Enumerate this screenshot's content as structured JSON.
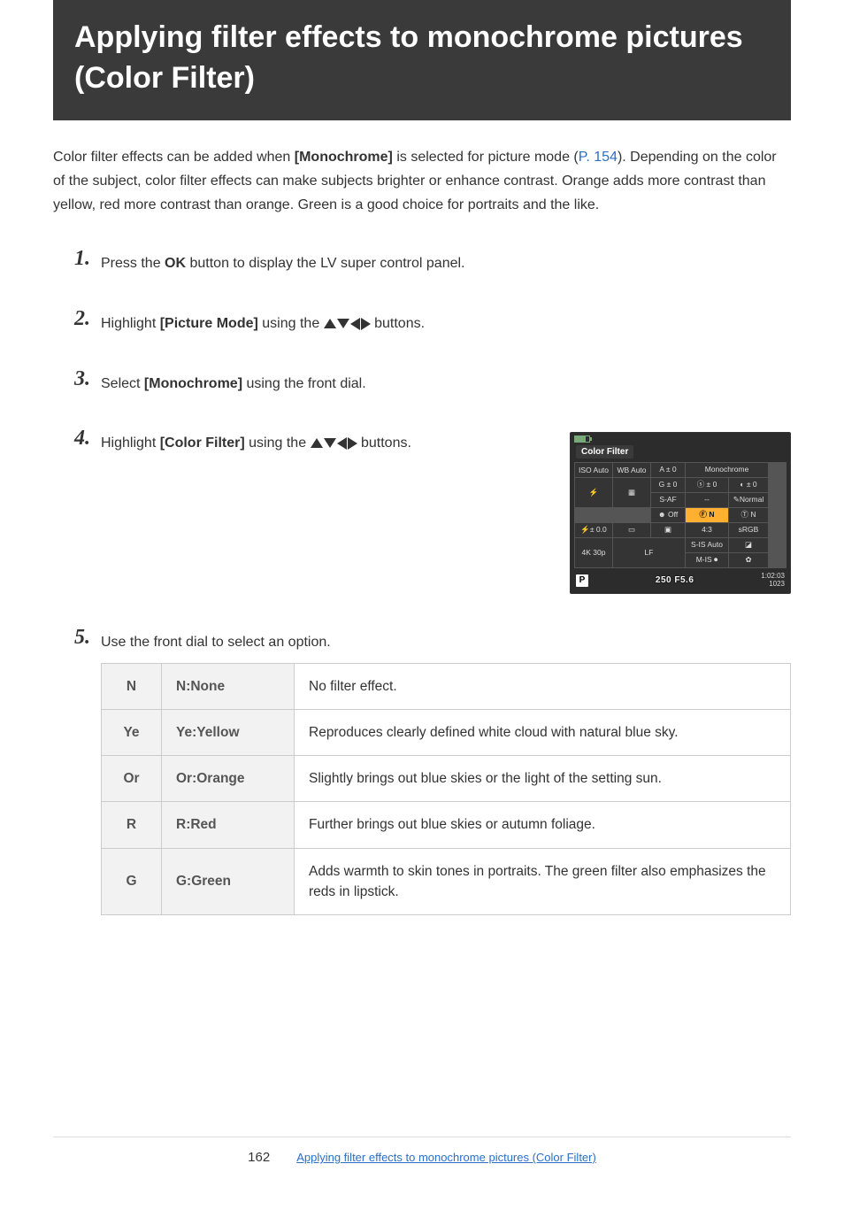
{
  "title": "Applying filter effects to monochrome pictures (Color Filter)",
  "intro": {
    "p1a": "Color filter effects can be added when ",
    "bold1": "[Monochrome]",
    "p1b": " is selected for picture mode (",
    "link": "P. 154",
    "p1c": "). Depending on the color of the subject, color filter effects can make subjects brighter or enhance contrast. Orange adds more contrast than yellow, red more contrast than orange. Green is a good choice for portraits and the like."
  },
  "steps": [
    {
      "pre": "Press the ",
      "bold": "OK",
      "post": " button to display the LV super control panel."
    },
    {
      "pre": "Highlight ",
      "bold": "[Picture Mode]",
      "post": " using the ",
      "arrows": true,
      "post2": " buttons."
    },
    {
      "pre": "Select ",
      "bold": "[Monochrome]",
      "post": " using the front dial."
    },
    {
      "pre": "Highlight ",
      "bold": "[Color Filter]",
      "post": " using the ",
      "arrows": true,
      "post2": " buttons.",
      "panel": true
    },
    {
      "pre": "Use the front dial to select an option."
    }
  ],
  "panel": {
    "title": "Color Filter",
    "cells": {
      "iso": "ISO\nAuto",
      "wb": "WB\nAuto",
      "a0": "A ± 0",
      "g0": "G ± 0",
      "mono": "Monochrome",
      "s0": "ⓢ ± 0",
      "c0": "◐ ± 0",
      "flash": "⚡",
      "wbgrid": "▦",
      "saf": "S-AF",
      "off": "☻ Off",
      "dash": "--",
      "fnhl": "Ⓕ N",
      "normal": "✎Normal",
      "tn": "Ⓣ N",
      "ev": "⚡± 0.0",
      "rect": "▭",
      "meter": "▣",
      "ratio": "4:3",
      "srgb": "sRGB",
      "sis": "S-IS Auto",
      "mis": "M-IS ⏺",
      "lf": "LF",
      "v4k": "4K\n30p",
      "sq1": "◪",
      "gear": "✿"
    },
    "bottom": {
      "mode": "P",
      "ss": "250 F5.6",
      "t": "1:02:03",
      "n": "1023"
    }
  },
  "options": [
    {
      "code": "N",
      "name": "N:None",
      "desc": "No filter effect."
    },
    {
      "code": "Ye",
      "name": "Ye:Yellow",
      "desc": "Reproduces clearly defined white cloud with natural blue sky."
    },
    {
      "code": "Or",
      "name": "Or:Orange",
      "desc": "Slightly brings out blue skies or the light of the setting sun."
    },
    {
      "code": "R",
      "name": "R:Red",
      "desc": "Further brings out blue skies or autumn foliage."
    },
    {
      "code": "G",
      "name": "G:Green",
      "desc": "Adds warmth to skin tones in portraits. The green filter also emphasizes the reds in lipstick."
    }
  ],
  "footer": {
    "page": "162",
    "link": "Applying filter effects to monochrome pictures (Color Filter)"
  }
}
